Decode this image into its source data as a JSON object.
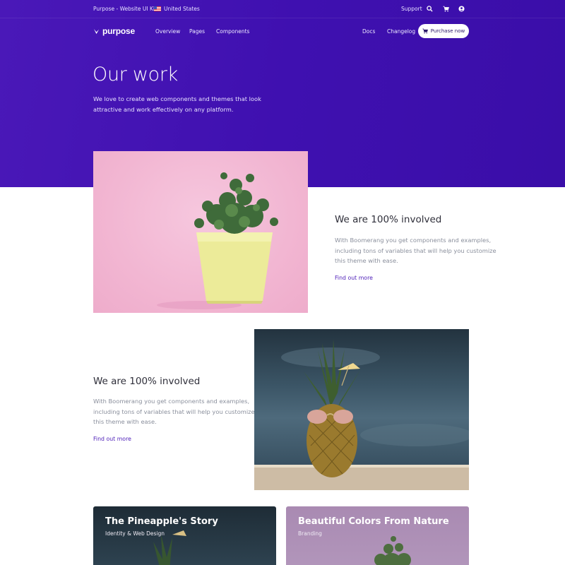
{
  "topbar": {
    "kit_label": "Purpose - Website UI Kit",
    "country": "United States",
    "support": "Support",
    "icons": [
      "flag-us-icon",
      "search-icon",
      "cart-icon",
      "user-icon"
    ]
  },
  "navbar": {
    "logo_text": "purpose",
    "links": [
      "Overview",
      "Pages",
      "Components"
    ],
    "right_links": [
      "Docs",
      "Changelog"
    ],
    "purchase_label": "Purchase now"
  },
  "hero": {
    "title": "Our work",
    "subtitle": "We love to create web components and themes that look attractive and work effectively on any platform."
  },
  "features": [
    {
      "title": "We are 100% involved",
      "text": "With Boomerang you get components and examples, including tons of variables that will help you customize this theme with ease.",
      "link": "Find out more"
    },
    {
      "title": "We are 100% involved",
      "text": "With Boomerang you get components and examples, including tons of variables that will help you customize this theme with ease.",
      "link": "Find out more"
    }
  ],
  "cards": [
    {
      "title": "The Pineapple's Story",
      "subtitle": "Identity & Web Design"
    },
    {
      "title": "Beautiful Colors From Nature",
      "subtitle": "Branding"
    }
  ],
  "colors": {
    "hero_bg": "#4316b4",
    "accent": "#4c1db8",
    "text_muted": "#8a8f9c"
  }
}
